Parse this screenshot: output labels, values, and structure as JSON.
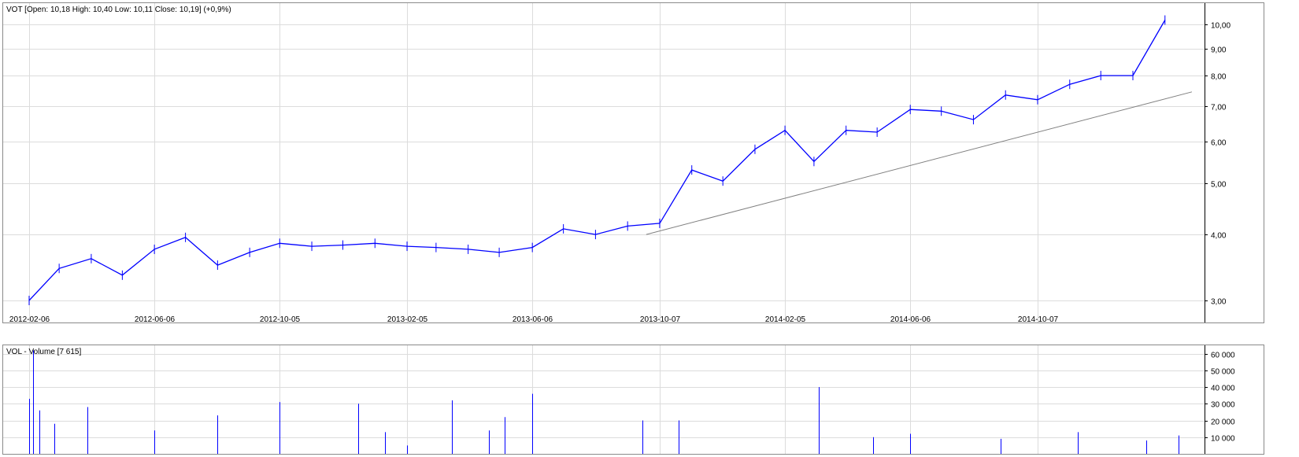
{
  "price_panel": {
    "header": {
      "symbol": "VOT",
      "open_label": "Open:",
      "open": "10,18",
      "high_label": "High:",
      "high": "10,40",
      "low_label": "Low:",
      "low": "10,11",
      "close_label": "Close:",
      "close": "10,19",
      "change": "(+0,9%)"
    }
  },
  "volume_panel": {
    "header": {
      "indicator": "VOL",
      "name": "Volume",
      "value": "7 615"
    }
  },
  "colors": {
    "series": "#0000ff",
    "trendline": "#808080",
    "grid": "#dcdcdc",
    "frame": "#8a8a8a"
  },
  "chart_data": [
    {
      "type": "line",
      "style": "ohlc-bars",
      "scale": "log",
      "ylim": [
        2.85,
        10.8
      ],
      "y_ticks": [
        "3,00",
        "4,00",
        "5,00",
        "6,00",
        "7,00",
        "8,00",
        "9,00",
        "10,00"
      ],
      "y_tick_values": [
        3,
        4,
        5,
        6,
        7,
        8,
        9,
        10
      ],
      "x_ticks": [
        "2012-02-06",
        "2012-06-06",
        "2012-10-05",
        "2013-02-05",
        "2013-06-06",
        "2013-10-07",
        "2014-02-05",
        "2014-06-06",
        "2014-10-07"
      ],
      "grid": true,
      "series": [
        {
          "x": [
            "2012-02-06",
            "2012-03-06",
            "2012-04-06",
            "2012-05-06",
            "2012-06-06",
            "2012-07-06",
            "2012-08-06",
            "2012-09-06",
            "2012-10-05",
            "2012-11-05",
            "2012-12-05",
            "2013-01-05",
            "2013-02-05",
            "2013-03-05",
            "2013-04-05",
            "2013-05-05",
            "2013-06-06",
            "2013-07-06",
            "2013-08-06",
            "2013-09-06",
            "2013-10-07",
            "2013-11-07",
            "2013-12-07",
            "2014-01-07",
            "2014-02-05",
            "2014-03-05",
            "2014-04-05",
            "2014-05-05",
            "2014-06-06",
            "2014-07-06",
            "2014-08-06",
            "2014-09-06",
            "2014-10-07",
            "2014-11-07",
            "2014-12-07",
            "2015-01-07",
            "2015-02-07"
          ],
          "values": [
            3.0,
            3.45,
            3.6,
            3.35,
            3.75,
            3.95,
            3.5,
            3.7,
            3.85,
            3.8,
            3.82,
            3.85,
            3.8,
            3.78,
            3.75,
            3.7,
            3.78,
            4.1,
            4.0,
            4.15,
            4.2,
            5.3,
            5.05,
            5.8,
            6.3,
            5.5,
            6.3,
            6.25,
            6.9,
            6.85,
            6.6,
            7.35,
            7.2,
            7.7,
            8.0,
            8.0,
            10.19
          ]
        }
      ],
      "trendline": {
        "from": [
          "2013-09-24",
          4.0
        ],
        "to": [
          "2015-03-05",
          7.45
        ]
      }
    },
    {
      "type": "bar",
      "ylim": [
        0,
        65000
      ],
      "y_ticks": [
        "10 000",
        "20 000",
        "30 000",
        "40 000",
        "50 000",
        "60 000"
      ],
      "y_tick_values": [
        10000,
        20000,
        30000,
        40000,
        50000,
        60000
      ],
      "grid": true,
      "series": [
        {
          "name": "Volume",
          "x": [
            "2012-02-06",
            "2012-02-10",
            "2012-02-16",
            "2012-03-01",
            "2012-04-02",
            "2012-06-06",
            "2012-08-06",
            "2012-10-05",
            "2012-12-20",
            "2013-01-15",
            "2013-02-05",
            "2013-03-20",
            "2013-04-25",
            "2013-05-10",
            "2013-06-06",
            "2013-09-20",
            "2013-10-25",
            "2014-03-10",
            "2014-05-01",
            "2014-06-06",
            "2014-09-01",
            "2014-11-15",
            "2015-01-20",
            "2015-02-20"
          ],
          "values": [
            33000,
            62000,
            26000,
            18000,
            28000,
            14000,
            23000,
            31000,
            30000,
            13000,
            5000,
            32000,
            14000,
            22000,
            36000,
            20000,
            20000,
            40000,
            10000,
            12000,
            9000,
            13000,
            8000,
            11000
          ]
        }
      ]
    }
  ]
}
